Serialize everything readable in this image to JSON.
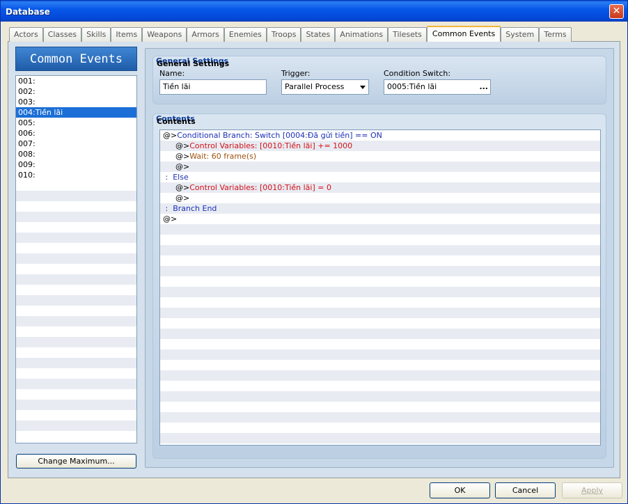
{
  "window": {
    "title": "Database",
    "close_label": "✕"
  },
  "tabs": [
    {
      "label": "Actors"
    },
    {
      "label": "Classes"
    },
    {
      "label": "Skills"
    },
    {
      "label": "Items"
    },
    {
      "label": "Weapons"
    },
    {
      "label": "Armors"
    },
    {
      "label": "Enemies"
    },
    {
      "label": "Troops"
    },
    {
      "label": "States"
    },
    {
      "label": "Animations"
    },
    {
      "label": "Tilesets"
    },
    {
      "label": "Common Events",
      "active": true
    },
    {
      "label": "System"
    },
    {
      "label": "Terms"
    }
  ],
  "common_events": {
    "header": "Common Events",
    "items": [
      "001:",
      "002:",
      "003:",
      "004:Tiền lãi",
      "005:",
      "006:",
      "007:",
      "008:",
      "009:",
      "010:"
    ],
    "selected_index": 3,
    "change_maximum_label": "Change Maximum..."
  },
  "general": {
    "title": "General Settings",
    "name_label": "Name:",
    "name_value": "Tiền lãi",
    "trigger_label": "Trigger:",
    "trigger_value": "Parallel Process",
    "switch_label": "Condition Switch:",
    "switch_value": "0005:Tiền lãi",
    "switch_button": "..."
  },
  "contents": {
    "title": "Contents",
    "lines": [
      {
        "indent": 0,
        "parts": [
          {
            "t": "@>",
            "c": "black"
          },
          {
            "t": "Conditional Branch: Switch [0004:Đã gửi tiền] == ON",
            "c": "blue"
          }
        ]
      },
      {
        "indent": 1,
        "parts": [
          {
            "t": "@>",
            "c": "black"
          },
          {
            "t": "Control Variables: [0010:Tiền lãi] += 1000",
            "c": "red"
          }
        ]
      },
      {
        "indent": 1,
        "parts": [
          {
            "t": "@>",
            "c": "black"
          },
          {
            "t": "Wait: 60 frame(s)",
            "c": "brown"
          }
        ]
      },
      {
        "indent": 1,
        "parts": [
          {
            "t": "@>",
            "c": "black"
          }
        ]
      },
      {
        "indent": 0,
        "parts": [
          {
            "t": " :  ",
            "c": "blue"
          },
          {
            "t": "Else",
            "c": "blue"
          }
        ]
      },
      {
        "indent": 1,
        "parts": [
          {
            "t": "@>",
            "c": "black"
          },
          {
            "t": "Control Variables: [0010:Tiền lãi] = 0",
            "c": "red"
          }
        ]
      },
      {
        "indent": 1,
        "parts": [
          {
            "t": "@>",
            "c": "black"
          }
        ]
      },
      {
        "indent": 0,
        "parts": [
          {
            "t": " :  ",
            "c": "blue"
          },
          {
            "t": "Branch End",
            "c": "blue"
          }
        ]
      },
      {
        "indent": 0,
        "parts": [
          {
            "t": "@>",
            "c": "black"
          }
        ]
      }
    ]
  },
  "footer": {
    "ok_label": "OK",
    "cancel_label": "Cancel",
    "apply_label": "Apply"
  }
}
